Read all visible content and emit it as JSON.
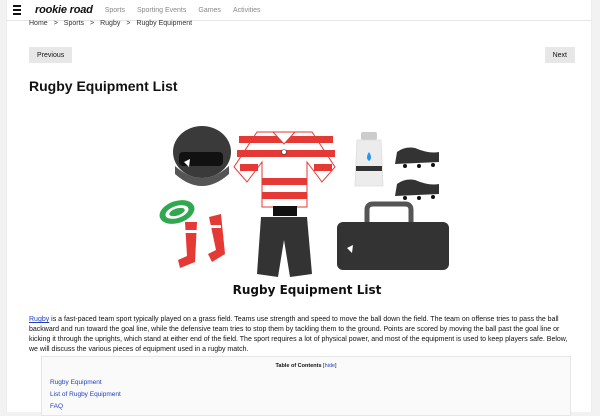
{
  "nav": {
    "logo": "rookie road",
    "links": [
      "Sports",
      "Sporting Events",
      "Games",
      "Activities"
    ]
  },
  "breadcrumb": [
    "Home",
    ">",
    "Sports",
    ">",
    "Rugby",
    ">",
    "Rugby Equipment"
  ],
  "pager": {
    "prev": "Previous",
    "next": "Next"
  },
  "page_title": "Rugby Equipment List",
  "hero": {
    "caption": "Rugby Equipment List"
  },
  "intro": {
    "link": "Rugby",
    "text": " is a fast-paced team sport typically played on a grass field. Teams use strength and speed to move the ball down the field. The team on offense tries to pass the ball backward and run toward the goal line, while the defensive team tries to stop them by tackling them to the ground. Points are scored by moving the ball past the goal line or kicking it through the uprights, which stand at either end of the field. The sport requires a lot of physical power, and most of the equipment is used to keep players safe.  Below, we will discuss the various pieces of equipment used in a rugby match."
  },
  "toc": {
    "title": "Table of Contents",
    "open": "[",
    "hide": "hide",
    "close": "]",
    "items": [
      "Rugby Equipment",
      "List of Rugby Equipment",
      "FAQ"
    ]
  },
  "colors": {
    "accent_red": "#e53935",
    "link_blue": "#1f3fbf",
    "dark": "#3a3a3a"
  }
}
